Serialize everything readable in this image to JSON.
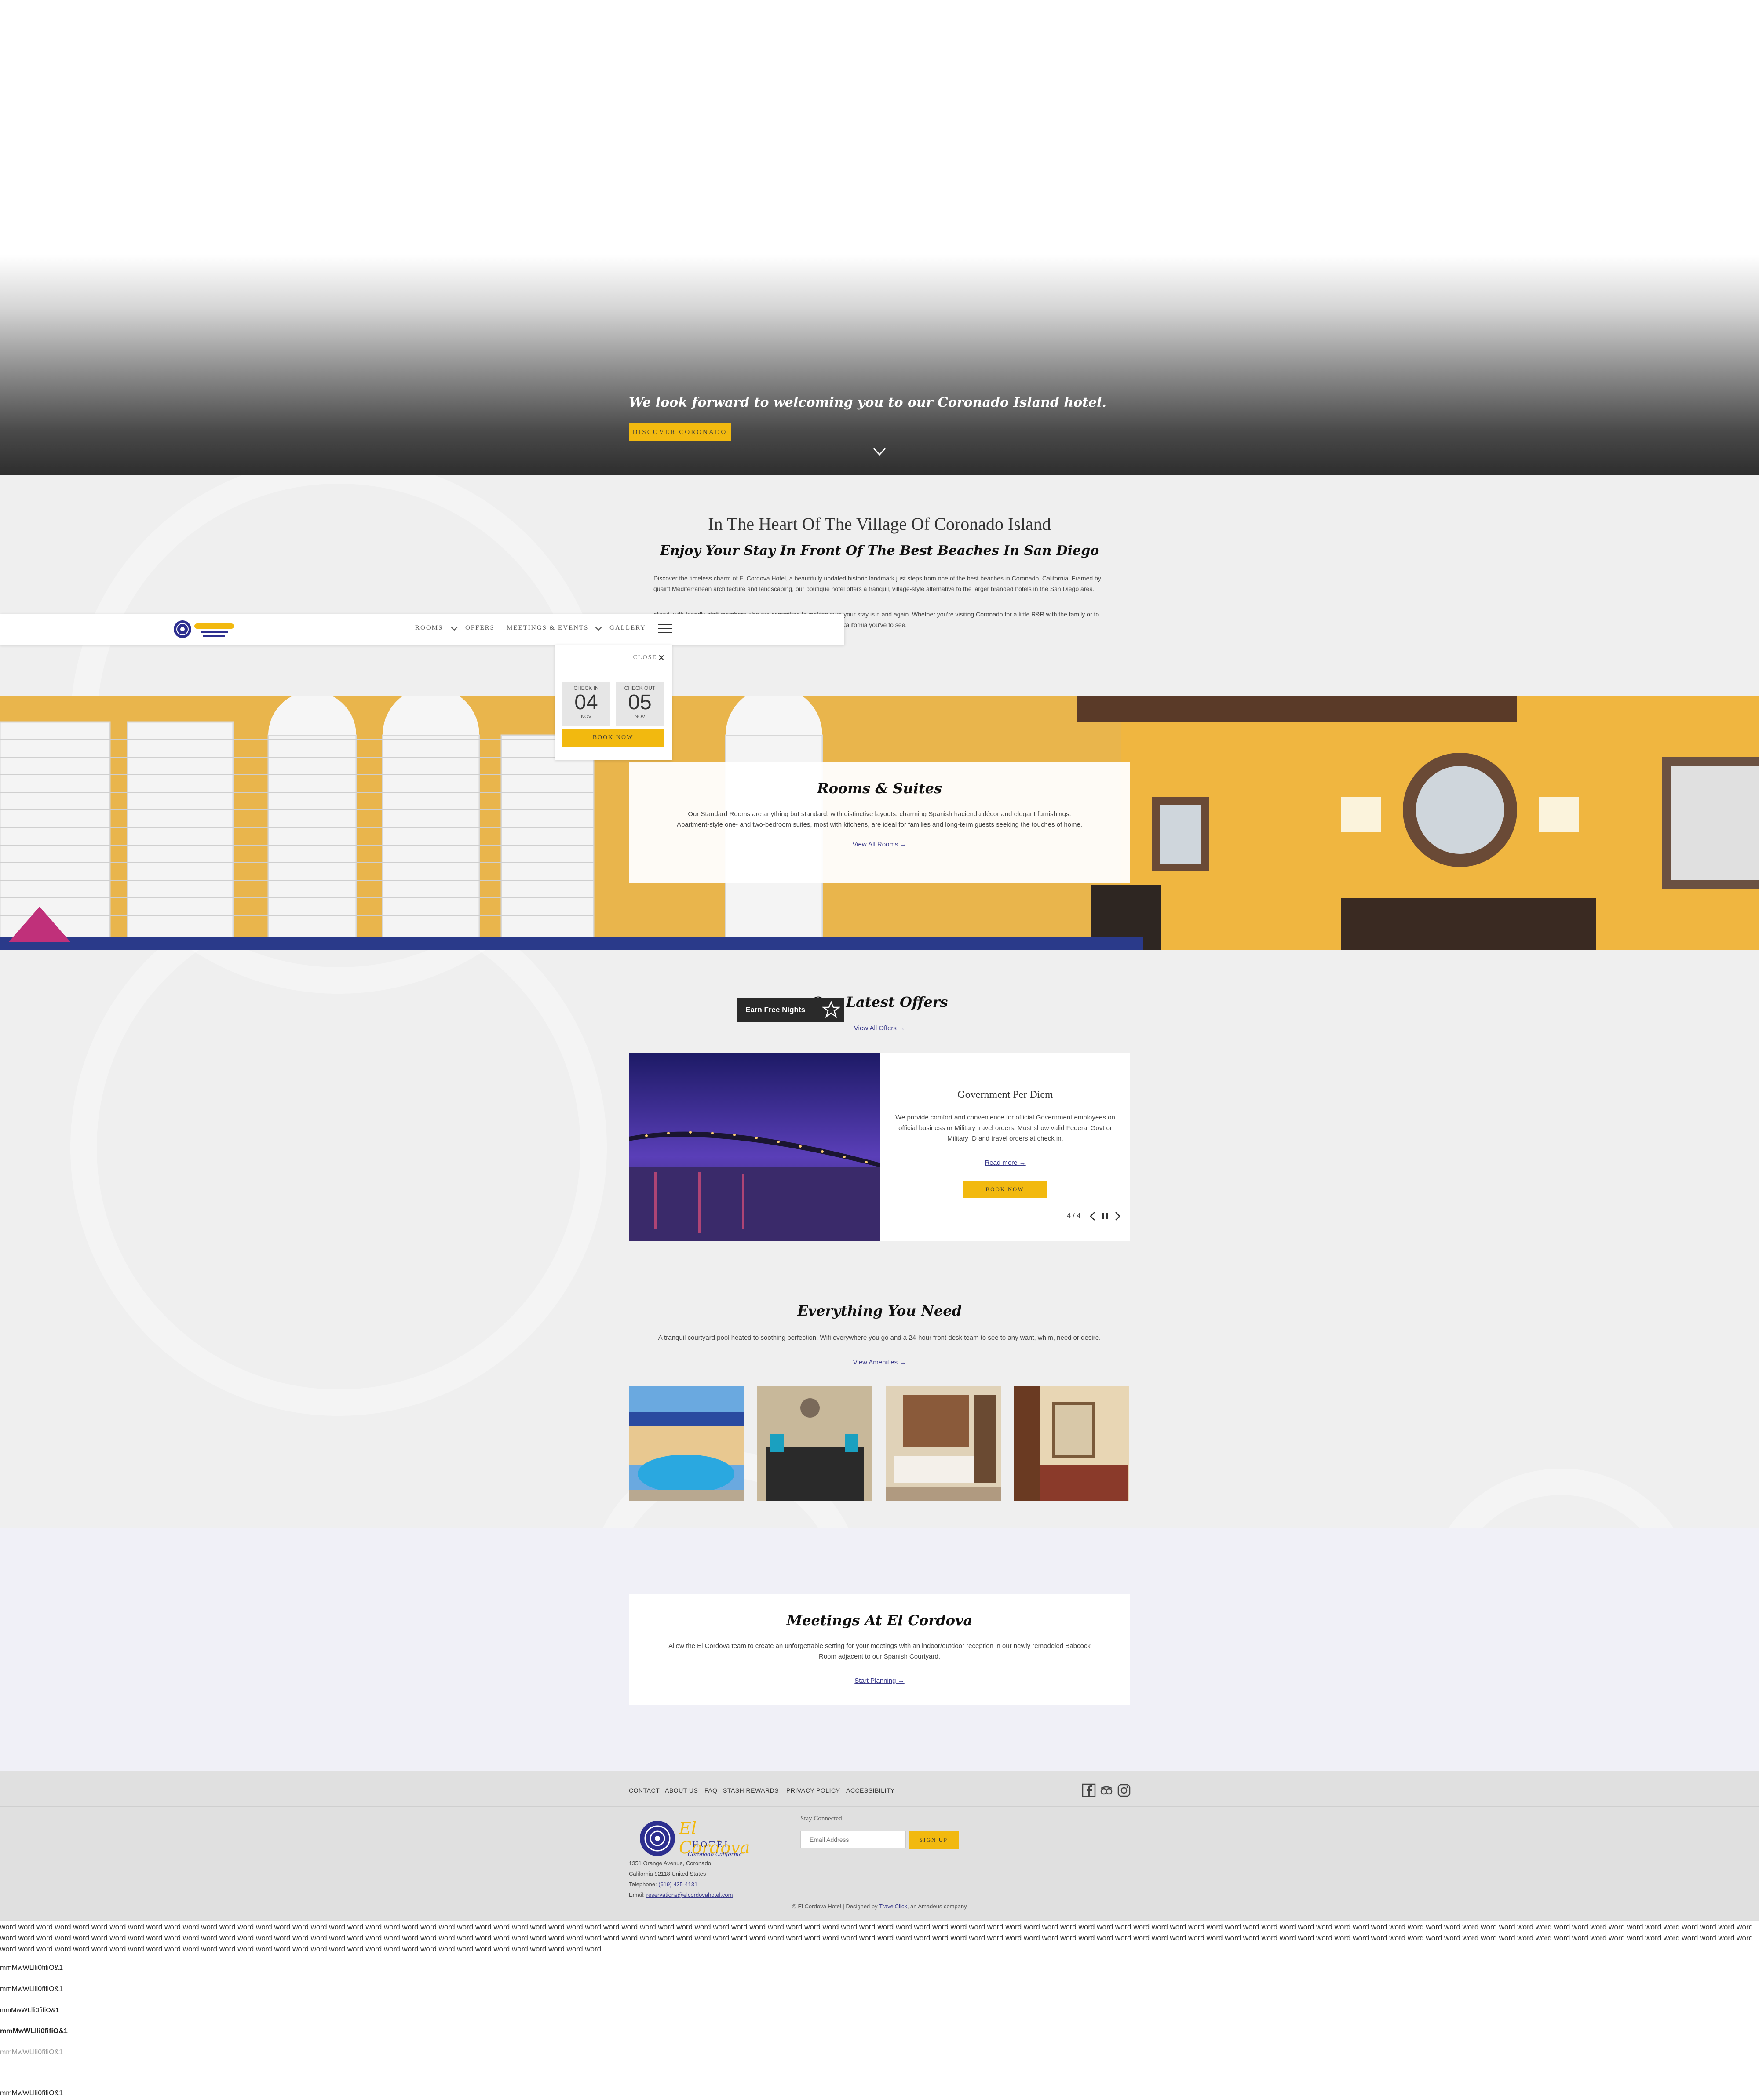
{
  "hero": {
    "tagline": "We look forward to welcoming you to our Coronado Island hotel.",
    "button": "DISCOVER CORONADO"
  },
  "nav": {
    "items": [
      "ROOMS",
      "OFFERS",
      "MEETINGS & EVENTS",
      "GALLERY"
    ]
  },
  "booking": {
    "close": "CLOSE",
    "check_in_label": "CHECK IN",
    "check_in_day": "04",
    "check_in_month": "NOV",
    "check_out_label": "CHECK OUT",
    "check_out_day": "05",
    "check_out_month": "NOV",
    "book_now": "BOOK NOW"
  },
  "intro": {
    "title": "In The Heart Of The Village Of Coronado Island",
    "subtitle": "Enjoy Your Stay In Front Of The Best Beaches In San Diego",
    "p1": "Discover the timeless charm of El Cordova Hotel, a beautifully updated historic landmark just steps from one of the best beaches in Coronado, California. Framed by quaint Mediterranean architecture and landscaping, our boutique hotel offers a tranquil, village-style alternative to the larger branded hotels in the San Diego area.",
    "p2": "alized, with friendly staff members who are committed to making sure your stay is n and again. Whether you're visiting Coronado for a little R&R with the family or to own, breathe in the ocean air and experience precisely the Southern California you've to see."
  },
  "rooms": {
    "title": "Rooms & Suites",
    "text": "Our Standard Rooms are anything but standard, with distinctive layouts, charming Spanish hacienda décor and elegant furnishings. Apartment-style one- and two-bedroom suites, most with kitchens, are ideal for families and long-term guests seeking the touches of home.",
    "link": "View All Rooms →"
  },
  "offers": {
    "earn": "Earn Free Nights",
    "title": "Our Latest Offers",
    "link": "View All Offers →",
    "card_title": "Government Per Diem",
    "card_text": "We provide comfort and convenience for official Government employees on official business or Military travel orders. Must show valid Federal Govt or Military ID and travel orders at check in.",
    "read_more": "Read more →",
    "book": "BOOK NOW",
    "counter": "4 / 4"
  },
  "amenities": {
    "title": "Everything You Need",
    "text": "A tranquil courtyard pool heated to soothing perfection. Wifi everywhere you go and a 24-hour front desk team to see to any want, whim, need or desire.",
    "link": "View Amenities →"
  },
  "meetings": {
    "title": "Meetings At El Cordova",
    "text": "Allow the El Cordova team to create an unforgettable setting for your meetings with an indoor/outdoor reception in our newly remodeled Babcock Room adjacent to our Spanish Courtyard.",
    "link": "Start Planning →"
  },
  "footer": {
    "links": [
      "CONTACT",
      "ABOUT US",
      "FAQ",
      "STASH REWARDS",
      "PRIVACY POLICY",
      "ACCESSIBILITY"
    ],
    "logo_text": "El Cordova",
    "logo_hotel": "HOTEL",
    "logo_place": "Coronado California",
    "address1": "1351 Orange Avenue, Coronado,",
    "address2": "California 92118 United States",
    "tel_label": "Telephone:",
    "tel": "(619) 435-4131",
    "email_label": "Email:",
    "email": "reservations@elcordovahotel.com",
    "stay_connected": "Stay Connected",
    "email_placeholder": "Email Address",
    "signup": "SIGN UP",
    "copyright_pre": "© El Cordova Hotel | Designed by",
    "copyright_link": "TravelClick",
    "copyright_post": ", an Amadeus company"
  },
  "filler": {
    "word": "word",
    "count": 225,
    "samples": [
      "mmMwWLlli0fifiO&1",
      "mmMwWLlli0fifiO&1",
      "mmMwWLlli0fifiO&1",
      "mmMwWLlli0fifiO&1",
      "mmMwWLlli0fifiO&1",
      "mmMwWLlli0fifiO&1"
    ]
  },
  "colors": {
    "accent": "#f2b90f",
    "navy": "#2d2f8f",
    "band": "#efefef",
    "meetings_band": "#f0f0f7",
    "footer": "#e0e0e0"
  }
}
